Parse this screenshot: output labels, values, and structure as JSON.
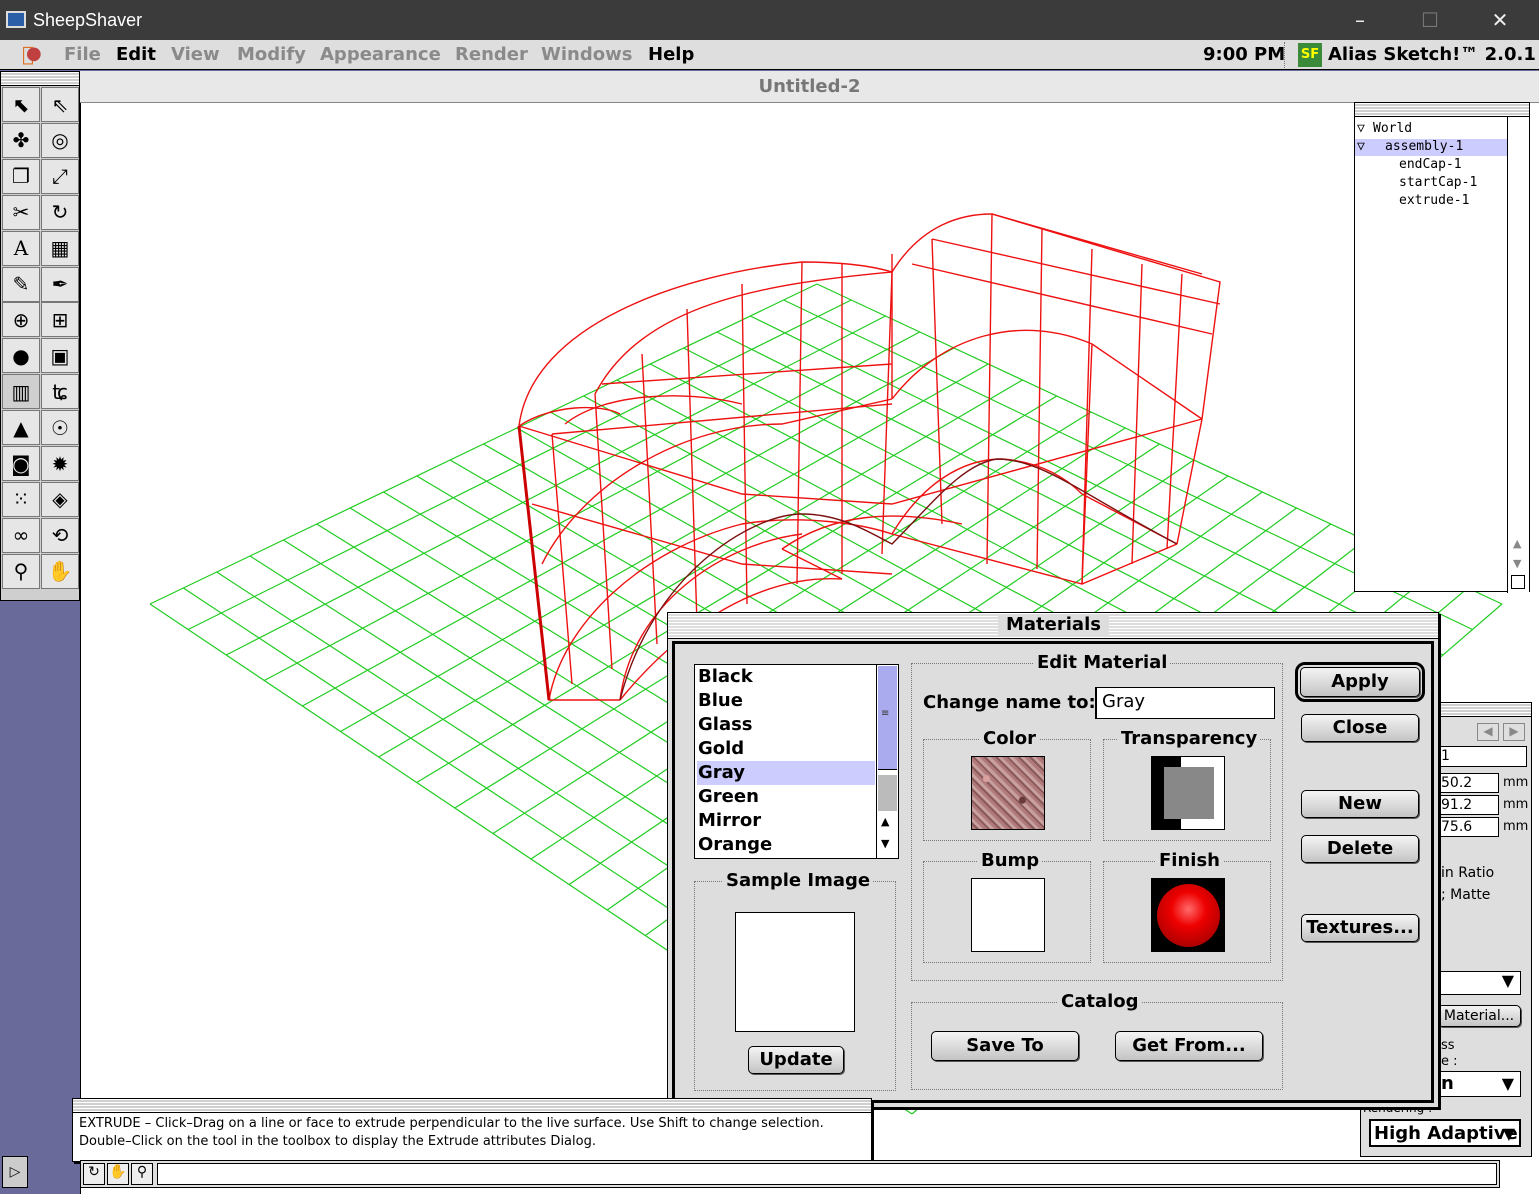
{
  "host": {
    "title": "SheepShaver",
    "buttons": [
      "–",
      "☐",
      "✕"
    ]
  },
  "menubar": {
    "items": [
      {
        "label": "File",
        "enabled": false
      },
      {
        "label": "Edit",
        "enabled": true
      },
      {
        "label": "View",
        "enabled": false
      },
      {
        "label": "Modify",
        "enabled": false
      },
      {
        "label": "Appearance",
        "enabled": false
      },
      {
        "label": "Render",
        "enabled": false
      },
      {
        "label": "Windows",
        "enabled": false
      },
      {
        "label": "Help",
        "enabled": true
      }
    ],
    "clock": "9:00 PM",
    "app": "Alias Sketch!™ 2.0.1"
  },
  "document": {
    "title": "Untitled-2"
  },
  "hierarchy": {
    "items": [
      {
        "label": "World",
        "expanded": true
      },
      {
        "label": "assembly-1",
        "expanded": true,
        "selected": true
      },
      {
        "label": "endCap-1"
      },
      {
        "label": "startCap-1"
      },
      {
        "label": "extrude-1"
      }
    ]
  },
  "inspector": {
    "field1": "1",
    "values": [
      {
        "value": "50.2",
        "unit": "mm"
      },
      {
        "value": "91.2",
        "unit": "mm"
      },
      {
        "value": "75.6",
        "unit": "mm"
      }
    ],
    "opt1": "in Ratio",
    "opt2": "; Matte",
    "material_btn": "Material...",
    "label_ss": "ss",
    "label_e": "e :",
    "dropdown2": "n",
    "rendering_label": "Rendering :",
    "rendering_value": "High Adaptive"
  },
  "materials": {
    "title": "Materials",
    "list": [
      "Black",
      "Blue",
      "Glass",
      "Gold",
      "Gray",
      "Green",
      "Mirror",
      "Orange"
    ],
    "selected": "Gray",
    "sample_image": "Sample Image",
    "update": "Update",
    "edit_material": "Edit Material",
    "change_name_label": "Change name to:",
    "change_name_value": "Gray",
    "color": "Color",
    "transparency": "Transparency",
    "bump": "Bump",
    "finish": "Finish",
    "catalog": "Catalog",
    "save_to": "Save To",
    "get_from": "Get From...",
    "apply": "Apply",
    "close": "Close",
    "new": "New",
    "delete": "Delete",
    "textures": "Textures..."
  },
  "status": {
    "line1": "EXTRUDE – Click–Drag on a line or face to extrude perpendicular to the live surface.  Use Shift to change selection.",
    "line2": "Double–Click on the tool in the toolbox to display the Extrude attributes Dialog."
  },
  "colors": {
    "grid": "#22cc22",
    "wire": "#ee1111",
    "selection": "#ccccff"
  }
}
